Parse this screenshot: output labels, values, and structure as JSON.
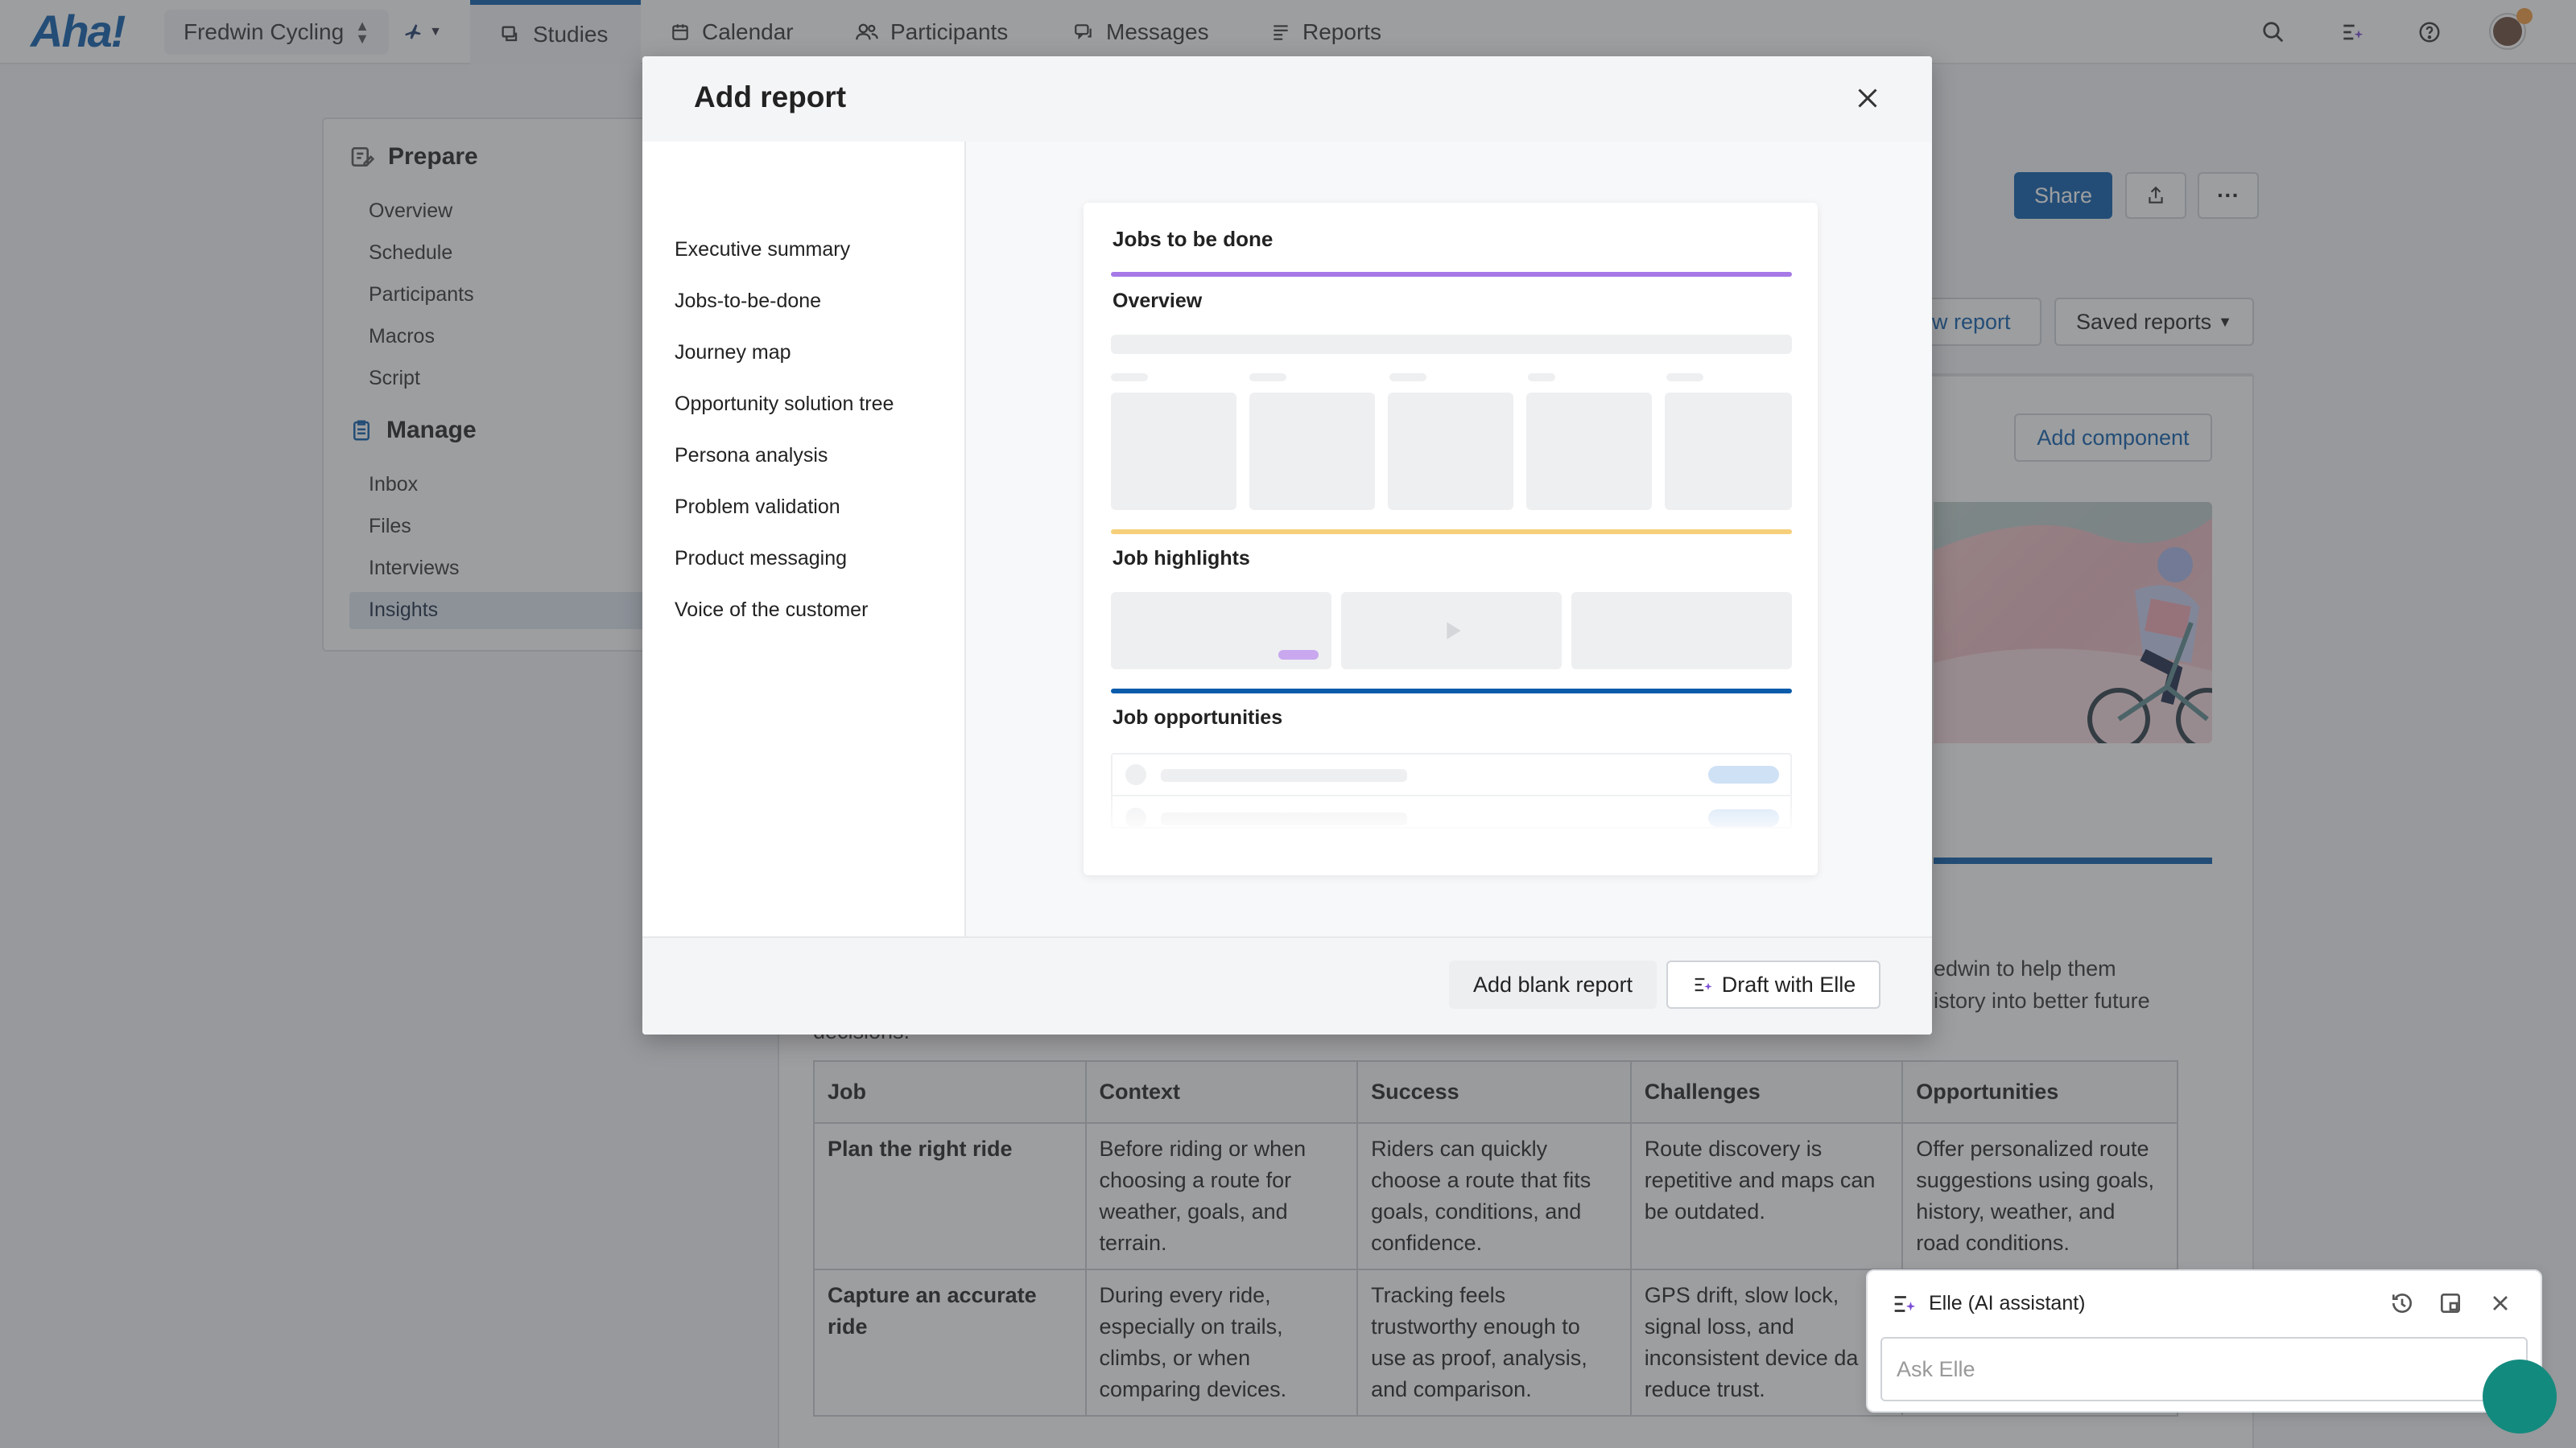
{
  "app": {
    "logo": "Aha!",
    "workspace": "Fredwin Cycling"
  },
  "nav": {
    "tabs": [
      {
        "label": "Studies",
        "icon": "studies-icon"
      },
      {
        "label": "Calendar",
        "icon": "calendar-icon"
      },
      {
        "label": "Participants",
        "icon": "participants-icon"
      },
      {
        "label": "Messages",
        "icon": "messages-icon"
      },
      {
        "label": "Reports",
        "icon": "reports-icon"
      }
    ]
  },
  "sidebar": {
    "prepare": {
      "title": "Prepare",
      "items": [
        "Overview",
        "Schedule",
        "Participants",
        "Macros",
        "Script"
      ]
    },
    "manage": {
      "title": "Manage",
      "items": [
        "Inbox",
        "Files",
        "Interviews",
        "Insights"
      ]
    },
    "active": "Insights"
  },
  "page": {
    "share_label": "Share",
    "new_report_label": "w report",
    "saved_reports_label": "Saved reports",
    "add_component_label": "Add component",
    "intro_line1": "edwin to help them",
    "intro_line2": "istory into better future",
    "intro_line3": "decisions."
  },
  "table": {
    "headers": [
      "Job",
      "Context",
      "Success",
      "Challenges",
      "Opportunities"
    ],
    "rows": [
      [
        "Plan the right ride",
        "Before riding or when choosing a route for weather, goals, and terrain.",
        "Riders can quickly choose a route that fits goals, conditions, and confidence.",
        "Route discovery is repetitive and maps can be outdated.",
        "Offer personalized route suggestions using goals, history, weather, and road conditions."
      ],
      [
        "Capture an accurate ride",
        "During every ride, especially on trails, climbs, or when comparing devices.",
        "Tracking feels trustworthy enough to use as proof, analysis, and comparison.",
        "GPS drift, slow lock, signal loss, and inconsistent device da reduce trust.",
        ""
      ]
    ]
  },
  "modal": {
    "title": "Add report",
    "templates": [
      "Executive summary",
      "Jobs-to-be-done",
      "Journey map",
      "Opportunity solution tree",
      "Persona analysis",
      "Problem validation",
      "Product messaging",
      "Voice of the customer"
    ],
    "preview": {
      "title": "Jobs to be done",
      "sections": [
        "Overview",
        "Job highlights",
        "Job opportunities"
      ],
      "colors": {
        "overview": "#a679e6",
        "highlights": "#f5cf7a",
        "opportunities": "#0b5cab"
      }
    },
    "add_blank_label": "Add blank report",
    "draft_label": "Draft with Elle"
  },
  "elle": {
    "title": "Elle (AI assistant)",
    "placeholder": "Ask Elle"
  },
  "colors": {
    "brand": "#0b5cab",
    "chat": "#138a7e"
  }
}
